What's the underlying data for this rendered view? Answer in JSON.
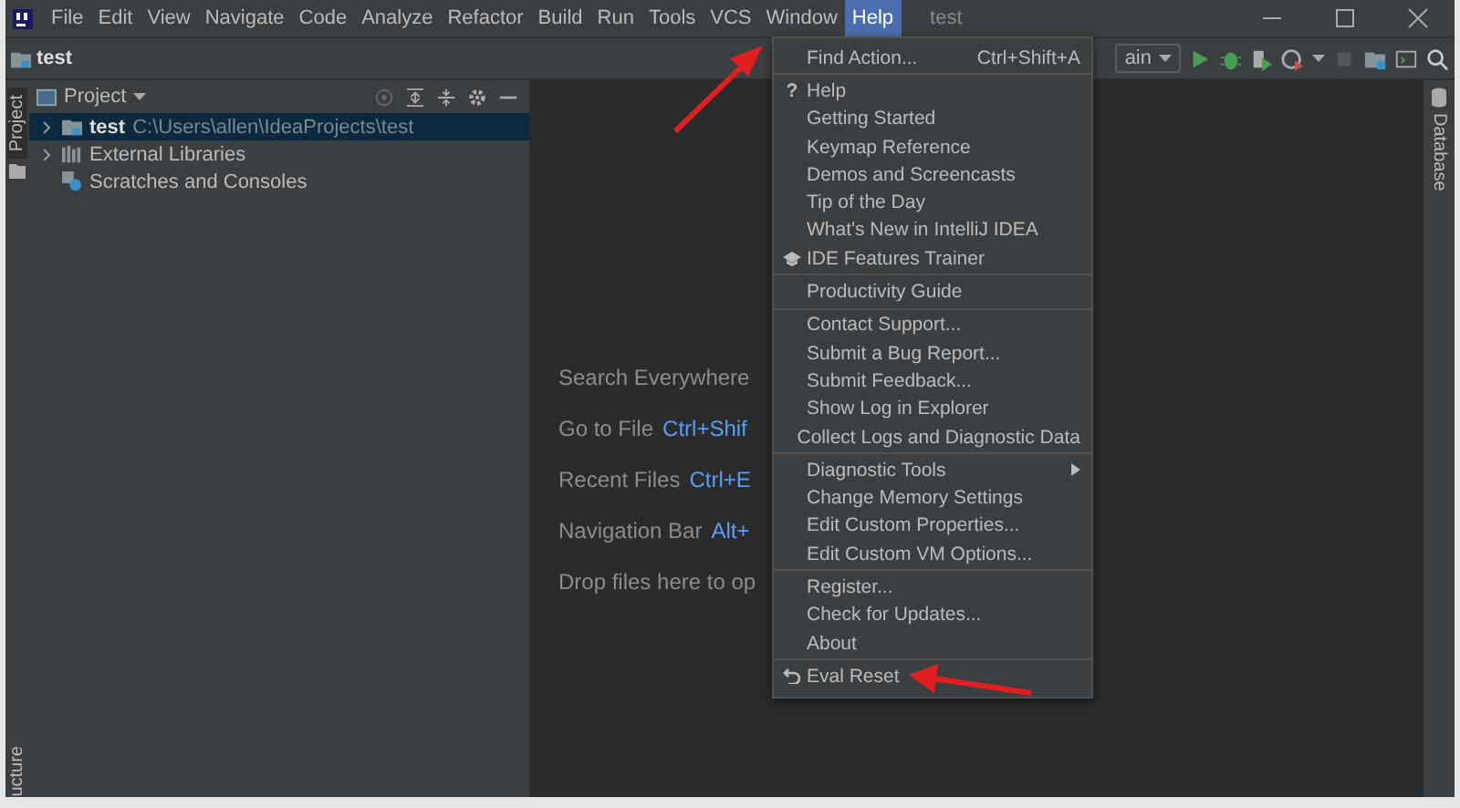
{
  "menu_bar": [
    {
      "label": "File",
      "selected": false
    },
    {
      "label": "Edit",
      "selected": false
    },
    {
      "label": "View",
      "selected": false
    },
    {
      "label": "Navigate",
      "selected": false
    },
    {
      "label": "Code",
      "selected": false
    },
    {
      "label": "Analyze",
      "selected": false
    },
    {
      "label": "Refactor",
      "selected": false
    },
    {
      "label": "Build",
      "selected": false
    },
    {
      "label": "Run",
      "selected": false
    },
    {
      "label": "Tools",
      "selected": false
    },
    {
      "label": "VCS",
      "selected": false
    },
    {
      "label": "Window",
      "selected": false
    },
    {
      "label": "Help",
      "selected": true
    }
  ],
  "window": {
    "title": "test"
  },
  "toolbar": {
    "breadcrumb": "test",
    "run_config": "ain"
  },
  "left_strip": {
    "top_tab": "Project",
    "bottom_tab": "ucture"
  },
  "right_strip": {
    "tab": "Database"
  },
  "project_panel": {
    "title": "Project",
    "tree": [
      {
        "label": "test",
        "path": "C:\\Users\\allen\\IdeaProjects\\test",
        "kind": "module",
        "expanded": false,
        "selected": true
      },
      {
        "label": "External Libraries",
        "kind": "libraries",
        "expanded": false,
        "selected": false
      },
      {
        "label": "Scratches and Consoles",
        "kind": "scratches",
        "selected": false
      }
    ]
  },
  "editor_hints": [
    {
      "label": "Search Everywhere"
    },
    {
      "label": "Go to File",
      "shortcut": "Ctrl+Shif"
    },
    {
      "label": "Recent Files",
      "shortcut": "Ctrl+E"
    },
    {
      "label": "Navigation Bar",
      "shortcut": "Alt+"
    },
    {
      "label": "Drop files here to op"
    }
  ],
  "help_menu": {
    "groups": [
      [
        {
          "label": "Find Action...",
          "shortcut": "Ctrl+Shift+A"
        }
      ],
      [
        {
          "label": "Help",
          "kind": "glyph",
          "glyph": "?"
        },
        {
          "label": "Getting Started"
        },
        {
          "label": "Keymap Reference"
        },
        {
          "label": "Demos and Screencasts"
        },
        {
          "label": "Tip of the Day"
        },
        {
          "label": "What's New in IntelliJ IDEA"
        },
        {
          "label": "IDE Features Trainer",
          "kind": "trainer"
        }
      ],
      [
        {
          "label": "Productivity Guide"
        }
      ],
      [
        {
          "label": "Contact Support..."
        },
        {
          "label": "Submit a Bug Report..."
        },
        {
          "label": "Submit Feedback..."
        },
        {
          "label": "Show Log in Explorer"
        },
        {
          "label": "Collect Logs and Diagnostic Data"
        }
      ],
      [
        {
          "label": "Diagnostic Tools",
          "submenu": true
        },
        {
          "label": "Change Memory Settings"
        },
        {
          "label": "Edit Custom Properties..."
        },
        {
          "label": "Edit Custom VM Options..."
        }
      ],
      [
        {
          "label": "Register..."
        },
        {
          "label": "Check for Updates..."
        },
        {
          "label": "About"
        }
      ],
      [
        {
          "label": "Eval Reset",
          "kind": "reset"
        }
      ]
    ]
  }
}
